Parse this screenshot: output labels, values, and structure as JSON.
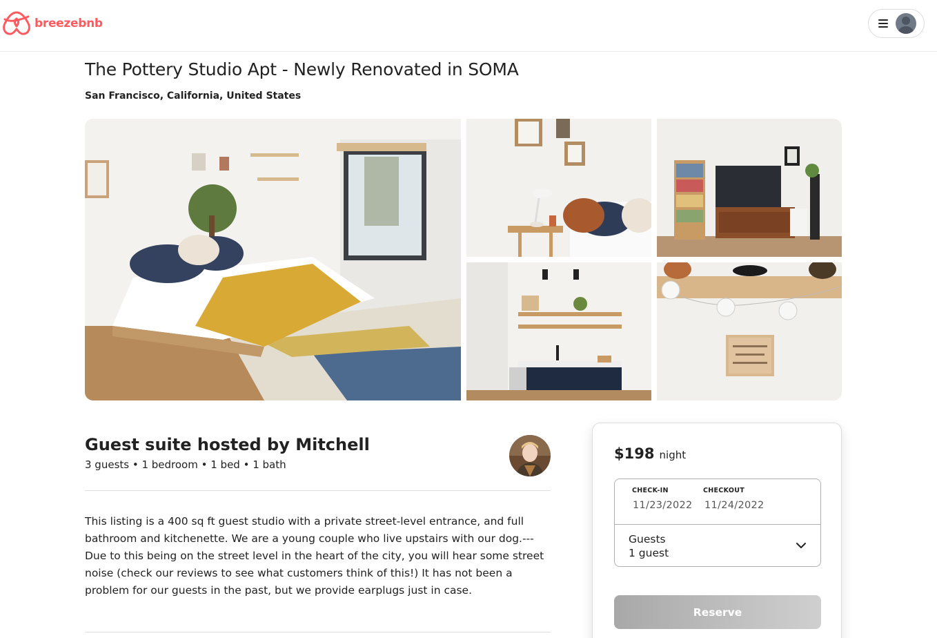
{
  "header": {
    "brand": "breezebnb",
    "logo_icon": "breezebnb-logo-icon",
    "menu_icon": "hamburger-menu-icon",
    "profile_icon": "user-avatar-icon",
    "brand_color": "#ff5a5f"
  },
  "listing": {
    "title": "The Pottery Studio Apt - Newly Renovated in SOMA",
    "location": "San Francisco, California, United States"
  },
  "photos": [
    {
      "subject": "bedroom"
    },
    {
      "subject": "bedside-nook"
    },
    {
      "subject": "living-area-tv"
    },
    {
      "subject": "kitchenette"
    },
    {
      "subject": "shelf-letterboard"
    }
  ],
  "host": {
    "heading": "Guest suite hosted by Mitchell",
    "details": "3 guests • 1 bedroom • 1 bed • 1 bath"
  },
  "description": "This listing is a 400 sq ft guest studio with a private street-level entrance, and full bathroom and kitchenette. We are a young couple who live upstairs with our dog.---Due to this being on the street level in the heart of the city, you will hear some street noise (check our reviews to see what customers think of this!) It has not been a problem for our guests in the past, but we provide earplugs just in case.",
  "booking": {
    "price": "$198",
    "price_unit": "night",
    "checkin_label": "CHECK-IN",
    "checkin_value": "11/23/2022",
    "checkout_label": "CHECKOUT",
    "checkout_value": "11/24/2022",
    "guests_label": "Guests",
    "guests_value": "1 guest",
    "reserve_label": "Reserve"
  }
}
